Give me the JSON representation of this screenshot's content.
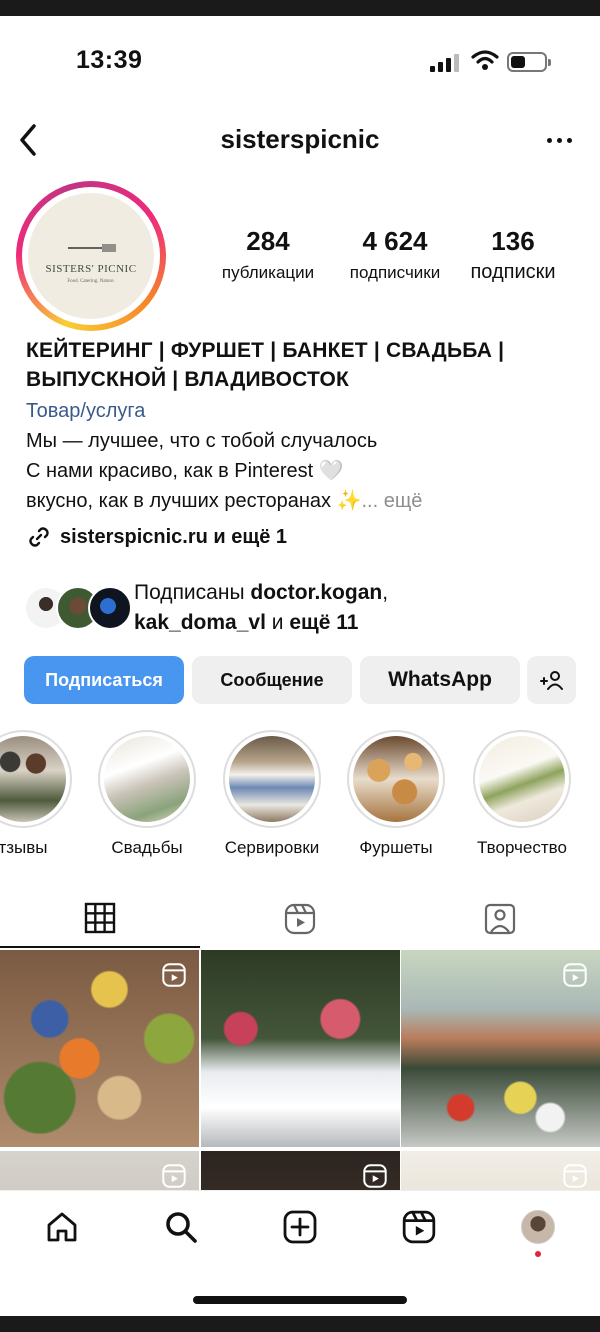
{
  "status_bar": {
    "time": "13:39",
    "battery_level": 0.35
  },
  "header": {
    "username": "sisterspicnic"
  },
  "avatar": {
    "brand": "SISTERS' PICNIC",
    "tagline": "Food. Catering. Nature."
  },
  "stats": [
    {
      "count": "284",
      "label": "публикации"
    },
    {
      "count": "4 624",
      "label": "подписчики"
    },
    {
      "count": "136",
      "label": "подписки"
    }
  ],
  "bio": {
    "name_line1": "КЕЙТЕРИНГ | ФУРШЕТ | БАНКЕТ | СВАДЬБА |",
    "name_line2": "ВЫПУСКНОЙ | ВЛАДИВОСТОК",
    "category": "Товар/услуга",
    "line1": "Мы — лучшее, что с тобой случалось",
    "line2": "С нами красиво, как в Pinterest 🤍",
    "line3": "вкусно, как в лучших ресторанах ✨",
    "more": "... ещё",
    "link": "sisterspicnic.ru и ещё 1"
  },
  "followed_by": {
    "prefix": "Подписаны ",
    "user1": "doctor.kogan",
    "sep": ",",
    "user2": "kak_doma_vl",
    "middle": " и ",
    "rest": "ещё 11"
  },
  "actions": {
    "follow": "Подписаться",
    "message": "Сообщение",
    "whatsapp": "WhatsApp"
  },
  "highlights": [
    {
      "label": "тзывы"
    },
    {
      "label": "Свадьбы"
    },
    {
      "label": "Сервировки"
    },
    {
      "label": "Фуршеты"
    },
    {
      "label": "Творчество"
    }
  ],
  "tabs": [
    "grid-icon",
    "reels-icon",
    "tagged-icon"
  ],
  "bottom_nav": [
    "home-icon",
    "search-icon",
    "create-icon",
    "reels-icon",
    "profile-avatar"
  ],
  "colors": {
    "primary_button": "#4896f0",
    "category_link": "#3a5a8c",
    "notification_dot": "#e0243b"
  }
}
